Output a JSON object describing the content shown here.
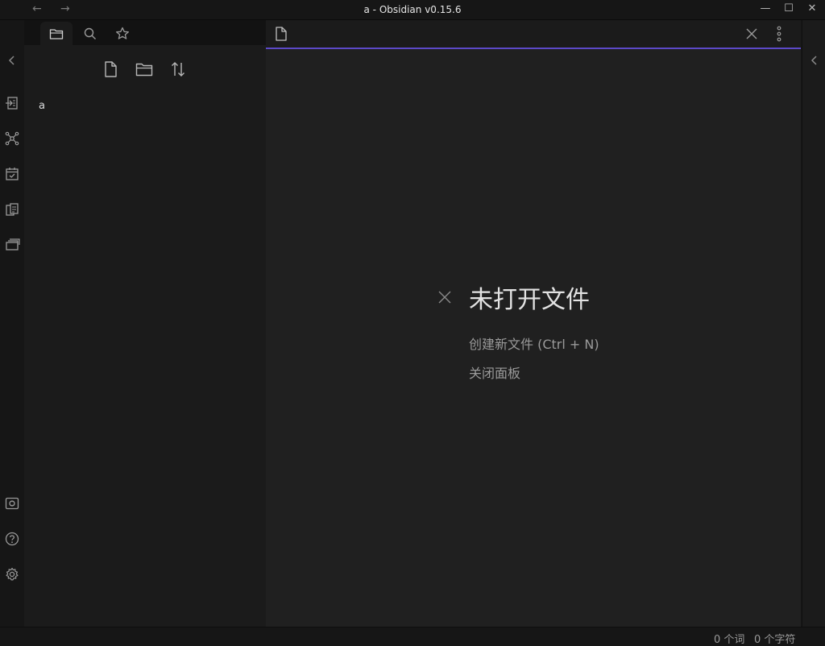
{
  "window": {
    "title": "a - Obsidian v0.15.6",
    "back_arrow": "←",
    "forward_arrow": "→",
    "minimize": "—",
    "maximize": "☐",
    "close": "✕"
  },
  "ribbon": {
    "top_icons": [
      "open-quick-switcher-icon",
      "graph-view-icon",
      "daily-note-icon",
      "templates-icon",
      "slides-icon"
    ],
    "bottom_icons": [
      "vault-switcher-icon",
      "help-icon",
      "settings-icon"
    ]
  },
  "sidebar": {
    "tabs": [
      "files-icon",
      "search-icon",
      "star-icon"
    ],
    "actions": [
      "new-note-icon",
      "new-folder-icon",
      "sort-icon"
    ],
    "files": [
      {
        "name": "a"
      }
    ]
  },
  "main": {
    "empty_title": "未打开文件",
    "create_new": "创建新文件 (Ctrl + N)",
    "close_pane": "关闭面板"
  },
  "status": {
    "words": "0 个词",
    "chars": "0 个字符"
  },
  "colors": {
    "accent": "#5c49c7",
    "background": "#202020"
  }
}
